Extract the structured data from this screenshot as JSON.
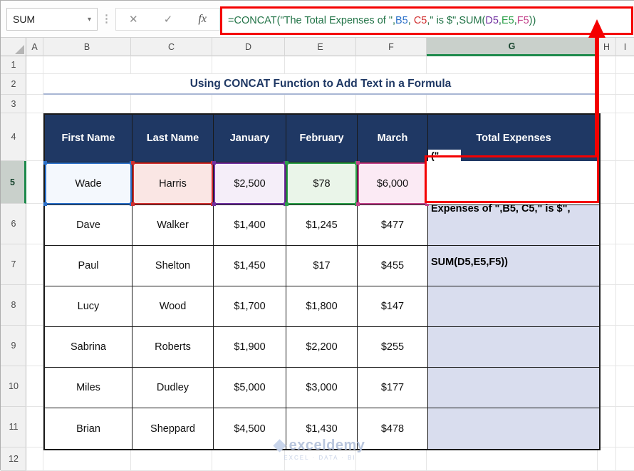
{
  "colors": {
    "accent_navy": "#1F3864",
    "annotation_red": "#F40000",
    "formula_green": "#217346",
    "ref_blue": "#2B70C9",
    "ref_red": "#D12F2F",
    "ref_purple": "#7030A0",
    "ref_green": "#2CA049",
    "ref_maroon": "#C2418A",
    "g_column_fill": "#D9DDEE",
    "selection_green": "#1E8A4C"
  },
  "formula_bar": {
    "name_box_value": "SUM",
    "dropdown_icon": "▾",
    "separator_dots": "⋮",
    "cancel_icon": "✕",
    "enter_icon": "✓",
    "fx_icon": "fx",
    "segments": [
      {
        "text": "=CONCAT(\"The Total Expenses of \",",
        "color_key": "formula_green"
      },
      {
        "text": "B5",
        "color_key": "ref_blue"
      },
      {
        "text": ", ",
        "color_key": "formula_green"
      },
      {
        "text": "C5",
        "color_key": "ref_red"
      },
      {
        "text": ",\" is $\",SUM(",
        "color_key": "formula_green"
      },
      {
        "text": "D5",
        "color_key": "ref_purple"
      },
      {
        "text": ",",
        "color_key": "formula_green"
      },
      {
        "text": "E5",
        "color_key": "ref_green"
      },
      {
        "text": ",",
        "color_key": "formula_green"
      },
      {
        "text": "F5",
        "color_key": "ref_maroon"
      },
      {
        "text": "))",
        "color_key": "formula_green"
      }
    ]
  },
  "grid": {
    "column_letters": [
      "A",
      "B",
      "C",
      "D",
      "E",
      "F",
      "G",
      "H",
      "I"
    ],
    "row_numbers": [
      "1",
      "2",
      "3",
      "4",
      "5",
      "6",
      "7",
      "8",
      "9",
      "10",
      "11",
      "12"
    ],
    "selected_column": "G",
    "selected_row": "5"
  },
  "sheet": {
    "title": "Using CONCAT Function to Add Text in a Formula",
    "table": {
      "headers": [
        "First Name",
        "Last Name",
        "January",
        "February",
        "March",
        "Total Expenses"
      ],
      "rows": [
        [
          "Wade",
          "Harris",
          "$2,500",
          "$78",
          "$6,000"
        ],
        [
          "Dave",
          "Walker",
          "$1,400",
          "$1,245",
          "$477"
        ],
        [
          "Paul",
          "Shelton",
          "$1,450",
          "$17",
          "$455"
        ],
        [
          "Lucy",
          "Wood",
          "$1,700",
          "$1,800",
          "$147"
        ],
        [
          "Sabrina",
          "Roberts",
          "$1,900",
          "$2,200",
          "$255"
        ],
        [
          "Miles",
          "Dudley",
          "$5,000",
          "$3,000",
          "$177"
        ],
        [
          "Brian",
          "Sheppard",
          "$4,500",
          "$1,430",
          "$478"
        ]
      ]
    },
    "editing_cell": {
      "peek_text": "(\"",
      "line1": "Expenses of \",B5, C5,\" is $\",",
      "line2": "SUM(D5,E5,F5))"
    },
    "ref_cells": [
      {
        "ref": "B5",
        "border": "#2B70C9",
        "fill": "#F4F8FD"
      },
      {
        "ref": "C5",
        "border": "#D12F2F",
        "fill": "#FAE6E4"
      },
      {
        "ref": "D5",
        "border": "#7030A0",
        "fill": "#F5EEF9"
      },
      {
        "ref": "E5",
        "border": "#2CA049",
        "fill": "#EAF5E9"
      },
      {
        "ref": "F5",
        "border": "#C2418A",
        "fill": "#FBEAF4"
      }
    ]
  },
  "watermark": {
    "brand": "exceldemy",
    "tagline": "EXCEL · DATA · BI"
  }
}
